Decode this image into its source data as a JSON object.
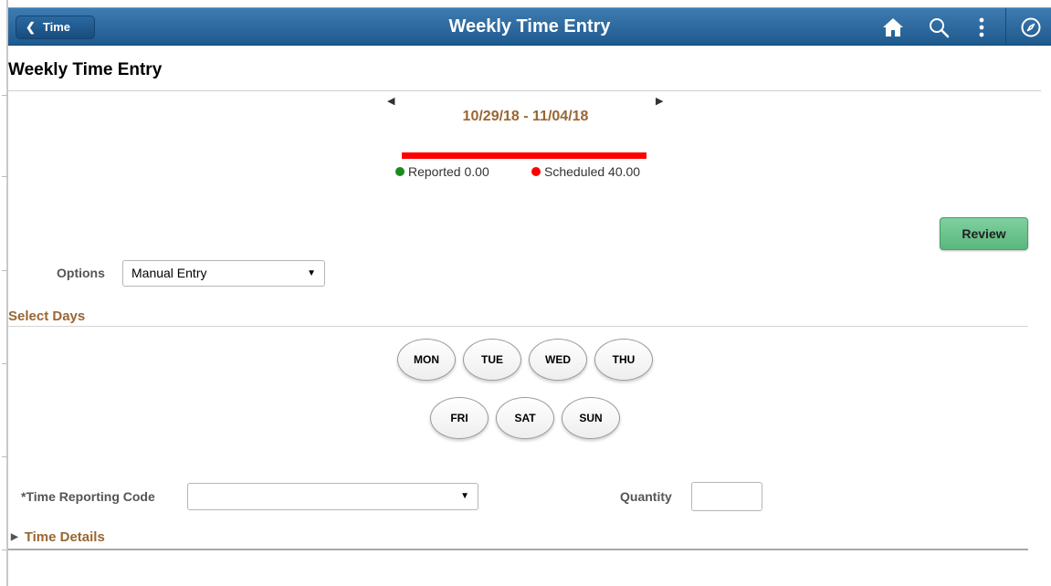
{
  "header": {
    "back_label": "Time",
    "title": "Weekly Time Entry",
    "icons": [
      "home-icon",
      "search-icon",
      "actions-menu-icon",
      "navbar-compass-icon"
    ]
  },
  "page": {
    "title": "Weekly Time Entry"
  },
  "period": {
    "range": "10/29/18 - 11/04/18",
    "reported": "Reported 0.00",
    "scheduled": "Scheduled 40.00",
    "reported_color": "#1e8a1e",
    "scheduled_color": "#ff0000",
    "progress_fraction": 0.0
  },
  "review_label": "Review",
  "options": {
    "label": "Options",
    "selected": "Manual Entry"
  },
  "select_days": {
    "title": "Select Days",
    "days": [
      "MON",
      "TUE",
      "WED",
      "THU",
      "FRI",
      "SAT",
      "SUN"
    ]
  },
  "time_reporting": {
    "label": "*Time Reporting Code",
    "selected": ""
  },
  "quantity": {
    "label": "Quantity",
    "value": ""
  },
  "time_details": {
    "label": "Time Details"
  },
  "colors": {
    "brand_blue": "#1f5a8e",
    "accent_brown": "#996633",
    "review_green": "#5ab77d"
  }
}
